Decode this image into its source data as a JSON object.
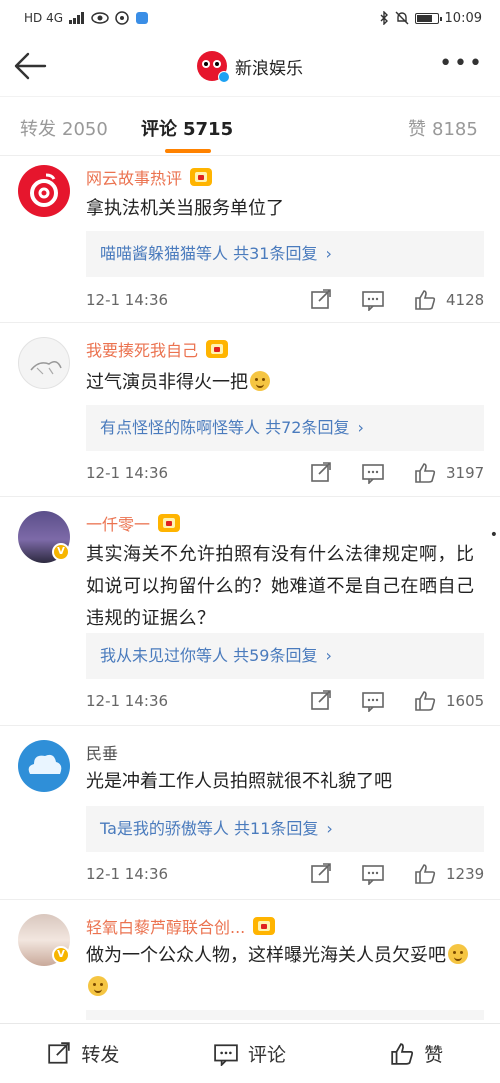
{
  "status_bar": {
    "network": "HD 4G",
    "time": "10:09"
  },
  "header": {
    "title": "新浪娱乐"
  },
  "tabs": {
    "repost": {
      "label": "转发",
      "count": "2050"
    },
    "comment": {
      "label": "评论",
      "count": "5715"
    },
    "like": {
      "label": "赞",
      "count": "8185"
    }
  },
  "comments": [
    {
      "user": "网云故事热评",
      "text": "拿执法机关当服务单位了",
      "replies": "喵喵酱躲猫猫等人 共31条回复",
      "time": "12-1 14:36",
      "likes": "4128"
    },
    {
      "user": "我要揍死我自己",
      "text": "过气演员非得火一把",
      "replies": "有点怪怪的陈啊怪等人 共72条回复",
      "time": "12-1 14:36",
      "likes": "3197"
    },
    {
      "user": "一仟零一",
      "text": "其实海关不允许拍照有没有什么法律规定啊，比如说可以拘留什么的？她难道不是自己在晒自己违规的证据么？",
      "replies": "我从未见过你等人 共59条回复",
      "time": "12-1 14:36",
      "likes": "1605"
    },
    {
      "user": "民垂",
      "text": "光是冲着工作人员拍照就很不礼貌了吧",
      "replies": "Ta是我的骄傲等人 共11条回复",
      "time": "12-1 14:36",
      "likes": "1239"
    },
    {
      "user": "轻氧白藜芦醇联合创...",
      "text": "做为一个公众人物，这样曝光海关人员欠妥吧"
    }
  ],
  "bottom_bar": {
    "repost": "转发",
    "comment": "评论",
    "like": "赞"
  }
}
